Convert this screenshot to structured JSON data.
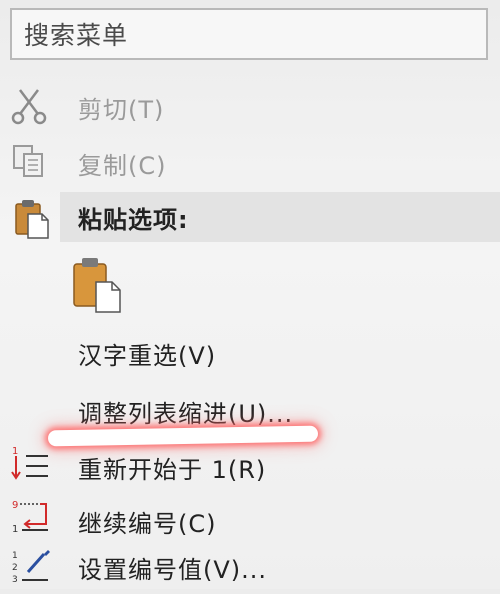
{
  "search": {
    "text": "搜索菜单"
  },
  "items": {
    "cut": {
      "label": "剪切(T)",
      "enabled": false,
      "icon": "scissors-icon"
    },
    "copy": {
      "label": "复制(C)",
      "enabled": false,
      "icon": "copy-icon"
    },
    "paste_header": {
      "label": "粘贴选项:",
      "icon": "paste-icon"
    },
    "paste_option": {
      "icon": "paste-keep-text-icon"
    },
    "reconvert": {
      "label": "汉字重选(V)"
    },
    "adjust_indent": {
      "label": "调整列表缩进(U)..."
    },
    "restart": {
      "label": "重新开始于 1(R)",
      "icon": "restart-numbering-icon"
    },
    "continue": {
      "label": "继续编号(C)",
      "icon": "continue-numbering-icon"
    },
    "set_value": {
      "label": "设置编号值(V)...",
      "icon": "set-numbering-value-icon"
    }
  },
  "colors": {
    "accent_red": "#d12a2a",
    "highlight": "#e3e3e3",
    "disabled": "#9a9a9a"
  }
}
